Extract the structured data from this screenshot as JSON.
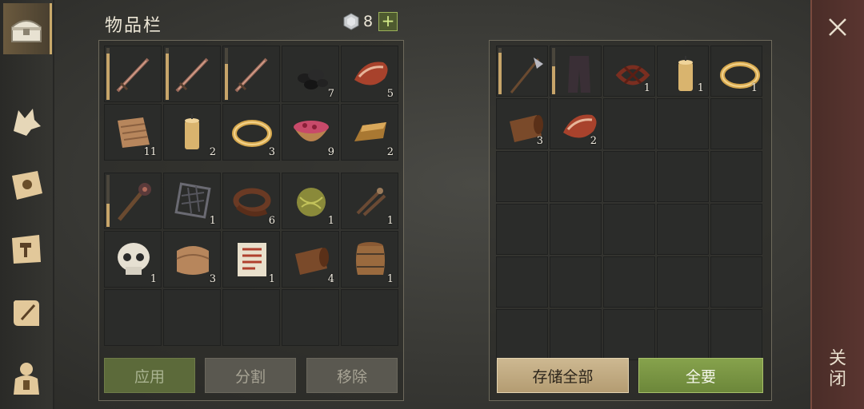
{
  "inventory": {
    "title": "物品栏",
    "gem_count": "8",
    "plus_label": "+",
    "top_cells": [
      {
        "item": "sword-icon",
        "dur": 0.9,
        "qty": ""
      },
      {
        "item": "sword-icon",
        "dur": 0.9,
        "qty": ""
      },
      {
        "item": "sword-icon",
        "dur": 0.7,
        "qty": ""
      },
      {
        "item": "coal-icon",
        "qty": "7"
      },
      {
        "item": "raw-meat-icon",
        "qty": "5"
      },
      {
        "item": "cloth-icon",
        "qty": "11"
      },
      {
        "item": "candle-icon",
        "qty": "2"
      },
      {
        "item": "gold-ring-icon",
        "qty": "3"
      },
      {
        "item": "berry-bowl-icon",
        "qty": "9"
      },
      {
        "item": "gold-ingot-icon",
        "qty": "2"
      }
    ],
    "bottom_cells": [
      {
        "item": "mace-icon",
        "dur": 0.45,
        "qty": ""
      },
      {
        "item": "metal-grate-icon",
        "qty": "1"
      },
      {
        "item": "leather-strap-icon",
        "qty": "6"
      },
      {
        "item": "herb-ball-icon",
        "qty": "1"
      },
      {
        "item": "nails-icon",
        "qty": "1"
      },
      {
        "item": "skull-icon",
        "qty": "1"
      },
      {
        "item": "fabric-icon",
        "qty": "3"
      },
      {
        "item": "recipe-scroll-icon",
        "qty": "1"
      },
      {
        "item": "leather-roll-icon",
        "qty": "4"
      },
      {
        "item": "barrel-icon",
        "qty": "1"
      },
      {
        "item": "",
        "qty": ""
      },
      {
        "item": "",
        "qty": ""
      },
      {
        "item": "",
        "qty": ""
      },
      {
        "item": "",
        "qty": ""
      },
      {
        "item": "",
        "qty": ""
      }
    ],
    "buttons": {
      "use": "应用",
      "split": "分割",
      "remove": "移除"
    }
  },
  "storage": {
    "cells": [
      {
        "item": "halberd-icon",
        "dur": 0.9,
        "qty": ""
      },
      {
        "item": "pants-icon",
        "dur": 0.6,
        "qty": ""
      },
      {
        "item": "rope-bundle-icon",
        "qty": "1"
      },
      {
        "item": "candle-icon",
        "qty": "1"
      },
      {
        "item": "gold-ring-icon",
        "qty": "1"
      },
      {
        "item": "leather-roll-icon",
        "qty": "3"
      },
      {
        "item": "raw-meat-icon",
        "qty": "2"
      }
    ],
    "store_all": "存储全部",
    "take_all": "全要"
  },
  "close": {
    "label": "关闭"
  },
  "colors": {
    "accent_gold": "#c9a96a",
    "green": "#7a9444",
    "panel_border": "#6e6a5c"
  }
}
